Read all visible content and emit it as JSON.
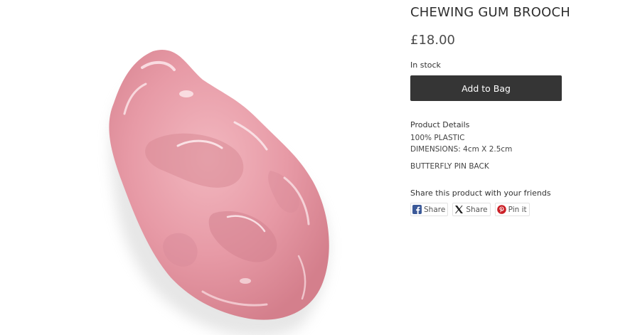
{
  "product": {
    "title": "CHEWING GUM BROOCH",
    "price": "£18.00",
    "stock": "In stock",
    "add_to_bag": "Add to Bag",
    "image_alt": "Pink chewing gum brooch",
    "details_heading": "Product Details",
    "details": [
      "100% PLASTIC",
      "DIMENSIONS: 4cm X 2.5cm",
      "BUTTERFLY PIN BACK"
    ]
  },
  "share": {
    "heading": "Share this product with your friends",
    "buttons": [
      {
        "label": "Share",
        "icon": "facebook-icon"
      },
      {
        "label": "Share",
        "icon": "x-icon"
      },
      {
        "label": "Pin it",
        "icon": "pinterest-icon"
      }
    ]
  },
  "colors": {
    "button_bg": "#353535",
    "gum_pink": "#e9a3ad",
    "facebook": "#3b5998",
    "pinterest": "#cb2027"
  }
}
